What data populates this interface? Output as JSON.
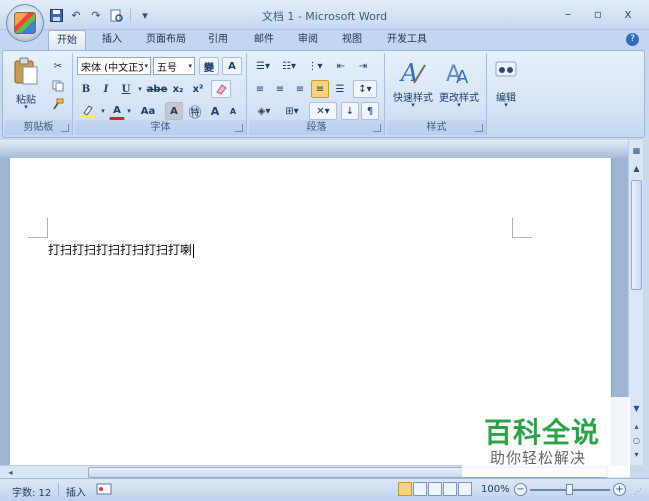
{
  "window": {
    "title": "文档 1 - Microsoft Word",
    "minimize": "–",
    "maximize": "▫",
    "close": "x"
  },
  "qat": {
    "save": "save-icon",
    "undo": "↶",
    "redo": "↷",
    "customize": "▾"
  },
  "tabs": [
    {
      "label": "开始",
      "active": true
    },
    {
      "label": "插入"
    },
    {
      "label": "页面布局"
    },
    {
      "label": "引用"
    },
    {
      "label": "邮件"
    },
    {
      "label": "审阅"
    },
    {
      "label": "视图"
    },
    {
      "label": "开发工具"
    }
  ],
  "ribbon": {
    "clipboard": {
      "label": "剪贴板",
      "paste": "粘贴"
    },
    "font": {
      "label": "字体",
      "font_name": "宋体 (中文正文",
      "font_size": "五号",
      "bold": "B",
      "italic": "I",
      "underline": "U",
      "strike": "abe",
      "subscript": "x₂",
      "superscript": "x²",
      "font_color": "A",
      "font_case": "Aa",
      "char_shade": "A",
      "enclose": "㊕",
      "grow": "A",
      "shrink": "A"
    },
    "paragraph": {
      "label": "段落"
    },
    "styles": {
      "label": "样式",
      "quick_styles": "快速样式",
      "change_styles": "更改样式"
    },
    "editing": {
      "label": "编辑"
    }
  },
  "document": {
    "text": "打扫打扫打扫打扫打扫打喇"
  },
  "status": {
    "word_count": "字数: 12",
    "mode": "插入",
    "zoom": "100%"
  },
  "watermark": {
    "title": "百科全说",
    "subtitle": "助你轻松解决"
  }
}
